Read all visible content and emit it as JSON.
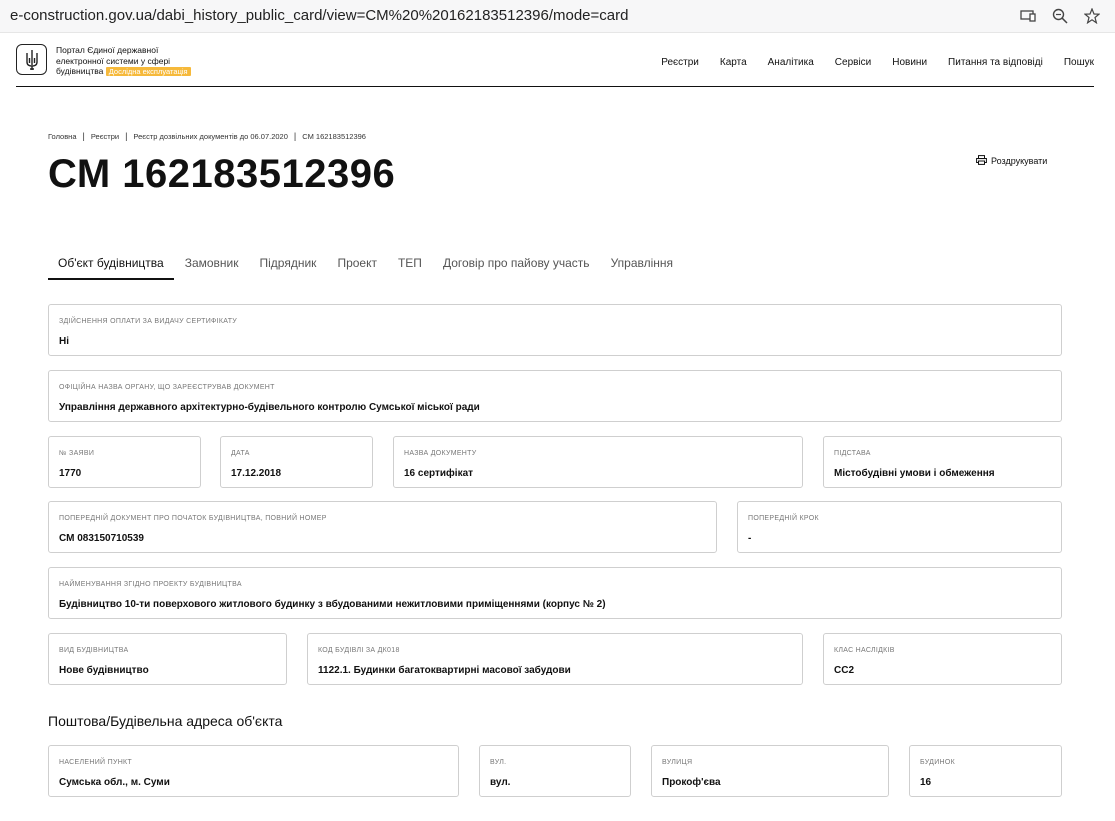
{
  "browser": {
    "url": "e-construction.gov.ua/dabi_history_public_card/view=CM%20%20162183512396/mode=card"
  },
  "header": {
    "portal_line1": "Портал Єдиної державної",
    "portal_line2": "електронної системи у сфері",
    "portal_line3": "будівництва",
    "badge": "Дослідна експлуатація",
    "nav": [
      "Реєстри",
      "Карта",
      "Аналітика",
      "Сервіси",
      "Новини",
      "Питання та відповіді",
      "Пошук"
    ]
  },
  "breadcrumb": [
    "Головна",
    "Реєстри",
    "Реєстр дозвільних документів до 06.07.2020",
    "СМ 162183512396"
  ],
  "title": "СМ 162183512396",
  "print_label": "Роздрукувати",
  "tabs": [
    "Об'єкт будівництва",
    "Замовник",
    "Підрядник",
    "Проект",
    "ТЕП",
    "Договір про пайову участь",
    "Управління"
  ],
  "fields": {
    "payment": {
      "label": "Здійснення оплати за видачу сертифікату",
      "value": "Ні"
    },
    "authority": {
      "label": "Офіційна назва органу, що зареєстрував документ",
      "value": "Управління державного архітектурно-будівельного контролю Сумської міської ради"
    },
    "app_no": {
      "label": "№ заяви",
      "value": "1770"
    },
    "date": {
      "label": "Дата",
      "value": "17.12.2018"
    },
    "doc_name": {
      "label": "Назва документу",
      "value": "16 сертифікат"
    },
    "basis": {
      "label": "Підстава",
      "value": "Містобудівні умови і обмеження"
    },
    "prev_doc": {
      "label": "Попередній документ про початок будівництва, повний номер",
      "value": "СМ 083150710539"
    },
    "prev_step": {
      "label": "Попередній крок",
      "value": "-"
    },
    "project_name": {
      "label": "Найменування згідно проекту будівництва",
      "value": "Будівництво 10-ти поверхового житлового будинку з вбудованими нежитловими приміщеннями (корпус № 2)"
    },
    "build_type": {
      "label": "Вид будівництва",
      "value": "Нове будівництво"
    },
    "dk018": {
      "label": "Код будівлі за ДК018",
      "value": "1122.1. Будинки багатоквартирні масової забудови"
    },
    "cc_class": {
      "label": "Клас наслідків",
      "value": "СС2"
    }
  },
  "address": {
    "title": "Поштова/Будівельна адреса об'єкта",
    "settlement": {
      "label": "Населений пункт",
      "value": "Сумська обл., м. Суми"
    },
    "street_type": {
      "label": "Вул.",
      "value": "вул."
    },
    "street": {
      "label": "Вулиця",
      "value": "Прокоф'єва"
    },
    "building": {
      "label": "Будинок",
      "value": "16"
    }
  }
}
